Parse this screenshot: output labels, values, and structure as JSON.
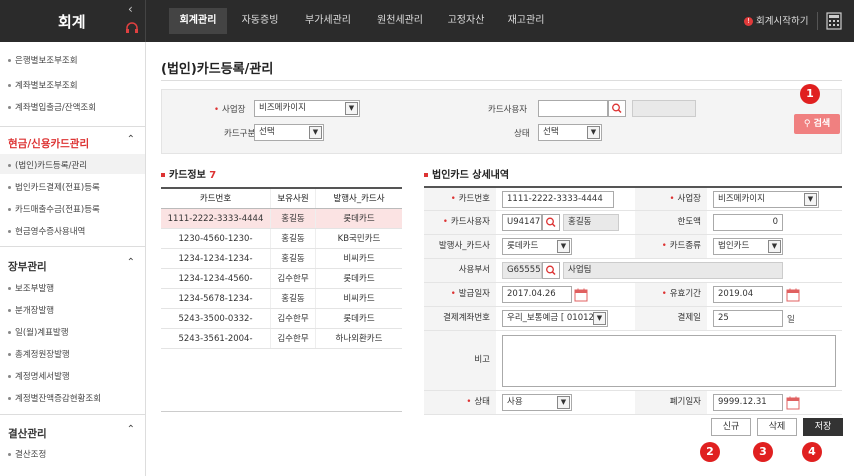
{
  "header": {
    "brand": "회계",
    "tabs": [
      {
        "label": "회계관리",
        "active": true
      },
      {
        "label": "자동증빙"
      },
      {
        "label": "부가세관리"
      },
      {
        "label": "원천세관리"
      },
      {
        "label": "고정자산"
      },
      {
        "label": "재고관리"
      }
    ],
    "start_link": "회계시작하기",
    "alert_icon": "!"
  },
  "sidebar": {
    "top_items": [
      "은행별보조부조회",
      "계좌별보조부조회",
      "계좌별입출금/잔액조회"
    ],
    "cash_card_group": {
      "title": "현금/신용카드관리",
      "items": [
        "(법인)카드등록/관리",
        "법인카드결제(전표)등록",
        "카드매출수금(전표)등록",
        "현금영수증사용내역"
      ]
    },
    "ledger_group": {
      "title": "장부관리",
      "items": [
        "보조부발행",
        "분개장발행",
        "일(월)계표발행",
        "총계정원장발행",
        "계정명세서발행",
        "계정별잔액증감현황조회"
      ]
    },
    "closing_group": {
      "title": "결산관리",
      "items": [
        "결산조정"
      ]
    }
  },
  "page": {
    "title": "(법인)카드등록/관리"
  },
  "search": {
    "workplace_label": "사업장",
    "workplace_value": "비즈메카이지",
    "card_type_label": "카드구분",
    "card_type_value": "선택",
    "card_user_label": "카드사용자",
    "card_user_value": "",
    "status_label": "상태",
    "status_value": "선택",
    "search_button": "검색"
  },
  "card_info": {
    "title": "카드정보",
    "count": "7",
    "columns": [
      "카드번호",
      "보유사원",
      "발행사_카드사"
    ],
    "rows": [
      [
        "1111-2222-3333-4444",
        "홍길동",
        "롯데카드"
      ],
      [
        "1230-4560-1230-",
        "홍길동",
        "KB국민카드"
      ],
      [
        "1234-1234-1234-",
        "홍길동",
        "비씨카드"
      ],
      [
        "1234-1234-4560-",
        "김수한무",
        "롯데카드"
      ],
      [
        "1234-5678-1234-",
        "홍길동",
        "비씨카드"
      ],
      [
        "5243-3500-0332-",
        "김수한무",
        "롯데카드"
      ],
      [
        "5243-3561-2004-",
        "김수한무",
        "하나외환카드"
      ]
    ]
  },
  "detail": {
    "title": "법인카드 상세내역",
    "card_number_label": "카드번호",
    "card_number_value": "1111-2222-3333-4444",
    "workplace_label": "사업장",
    "workplace_value": "비즈메카이지",
    "card_user_label": "카드사용자",
    "card_user_id": "U94147",
    "card_user_name": "홍길동",
    "limit_label": "한도액",
    "limit_value": "0",
    "issuer_label": "발행사_카드사",
    "issuer_value": "롯데카드",
    "card_kind_label": "카드종류",
    "card_kind_value": "법인카드",
    "dept_label": "사용부서",
    "dept_code": "G65555",
    "dept_name": "사업팀",
    "issue_date_label": "발급일자",
    "issue_date_value": "2017.04.26",
    "valid_label": "유효기간",
    "valid_value": "2019.04",
    "account_label": "결제계좌번호",
    "account_value": "우리_보통예금 [ 01012",
    "pay_day_label": "결제일",
    "pay_day_value": "25",
    "pay_day_unit": "일",
    "note_label": "비고",
    "note_value": "",
    "status_label": "상태",
    "status_value": "사용",
    "expire_label": "폐기일자",
    "expire_value": "9999.12.31"
  },
  "actions": {
    "new": "신규",
    "delete": "삭제",
    "save": "저장"
  },
  "badges": [
    "1",
    "2",
    "3",
    "4"
  ],
  "colors": {
    "topbar": "#2b2b2b",
    "accent_red": "#d33333",
    "search_button": "#f08080",
    "badge": "#e02020"
  }
}
